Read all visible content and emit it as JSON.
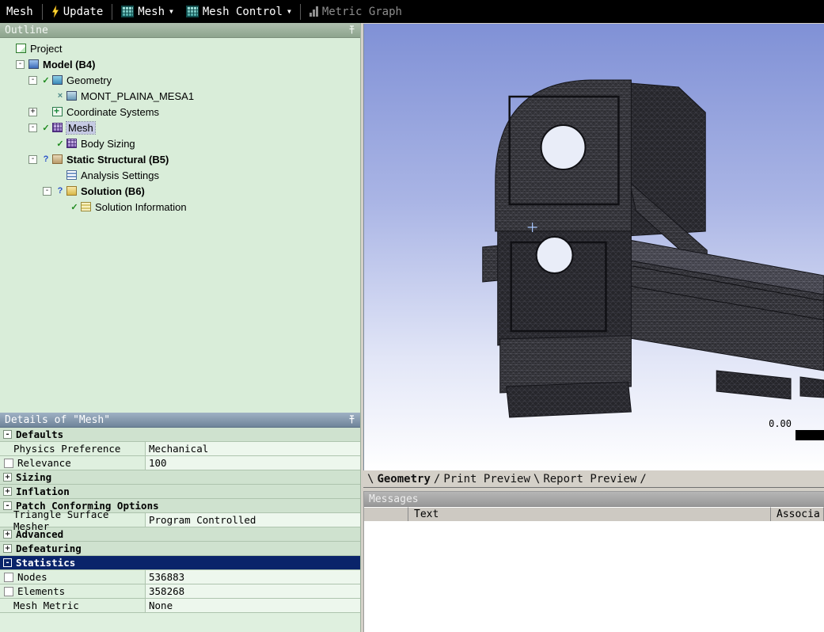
{
  "toolbar": {
    "group_label": "Mesh",
    "update_label": "Update",
    "mesh_dropdown_label": "Mesh",
    "mesh_control_label": "Mesh Control",
    "metric_graph_label": "Metric Graph"
  },
  "outline": {
    "title": "Outline",
    "tree": [
      {
        "label": "Project",
        "level": 0,
        "icon": "project"
      },
      {
        "label": "Model (B4)",
        "level": 1,
        "icon": "model",
        "expanded": true,
        "bold": true
      },
      {
        "label": "Geometry",
        "level": 2,
        "icon": "geometry",
        "expanded": true,
        "status": "check"
      },
      {
        "label": "MONT_PLAINA_MESA1",
        "level": 3,
        "icon": "part",
        "status": "x"
      },
      {
        "label": "Coordinate Systems",
        "level": 2,
        "icon": "axes",
        "expanded": false
      },
      {
        "label": "Mesh",
        "level": 2,
        "icon": "mesh",
        "expanded": true,
        "status": "check",
        "selected": true
      },
      {
        "label": "Body Sizing",
        "level": 3,
        "icon": "mesh",
        "status": "check"
      },
      {
        "label": "Static Structural (B5)",
        "level": 2,
        "icon": "structural",
        "expanded": true,
        "status": "question",
        "bold": true
      },
      {
        "label": "Analysis Settings",
        "level": 3,
        "icon": "settings"
      },
      {
        "label": "Solution (B6)",
        "level": 3,
        "icon": "solution",
        "expanded": true,
        "status": "question",
        "bold": true
      },
      {
        "label": "Solution Information",
        "level": 4,
        "icon": "info",
        "status": "check"
      }
    ]
  },
  "details": {
    "title": "Details of \"Mesh\"",
    "rows": [
      {
        "type": "section",
        "label": "Defaults",
        "expanded": true
      },
      {
        "type": "prop",
        "label": "Physics Preference",
        "value": "Mechanical"
      },
      {
        "type": "prop",
        "label": "Relevance",
        "value": "100",
        "checkbox": true
      },
      {
        "type": "section",
        "label": "Sizing",
        "expanded": false
      },
      {
        "type": "section",
        "label": "Inflation",
        "expanded": false
      },
      {
        "type": "section",
        "label": "Patch Conforming Options",
        "expanded": true
      },
      {
        "type": "prop",
        "label": "Triangle Surface Mesher",
        "value": "Program Controlled"
      },
      {
        "type": "section",
        "label": "Advanced",
        "expanded": false
      },
      {
        "type": "section",
        "label": "Defeaturing",
        "expanded": false
      },
      {
        "type": "section",
        "label": "Statistics",
        "expanded": true,
        "selected": true
      },
      {
        "type": "prop",
        "label": "Nodes",
        "value": "536883",
        "checkbox": true
      },
      {
        "type": "prop",
        "label": "Elements",
        "value": "358268",
        "checkbox": true
      },
      {
        "type": "prop",
        "label": "Mesh Metric",
        "value": "None"
      }
    ]
  },
  "viewport": {
    "scale_label": "0.00",
    "accent_colors": {
      "background_top": "#8091d6",
      "background_bottom": "#ffffff",
      "mesh_color": "#2e2e33"
    }
  },
  "tabs": [
    {
      "label": "Geometry",
      "active": true
    },
    {
      "label": "Print Preview",
      "active": false
    },
    {
      "label": "Report Preview",
      "active": false
    }
  ],
  "messages": {
    "title": "Messages",
    "columns": [
      "Text",
      "Associa"
    ]
  }
}
